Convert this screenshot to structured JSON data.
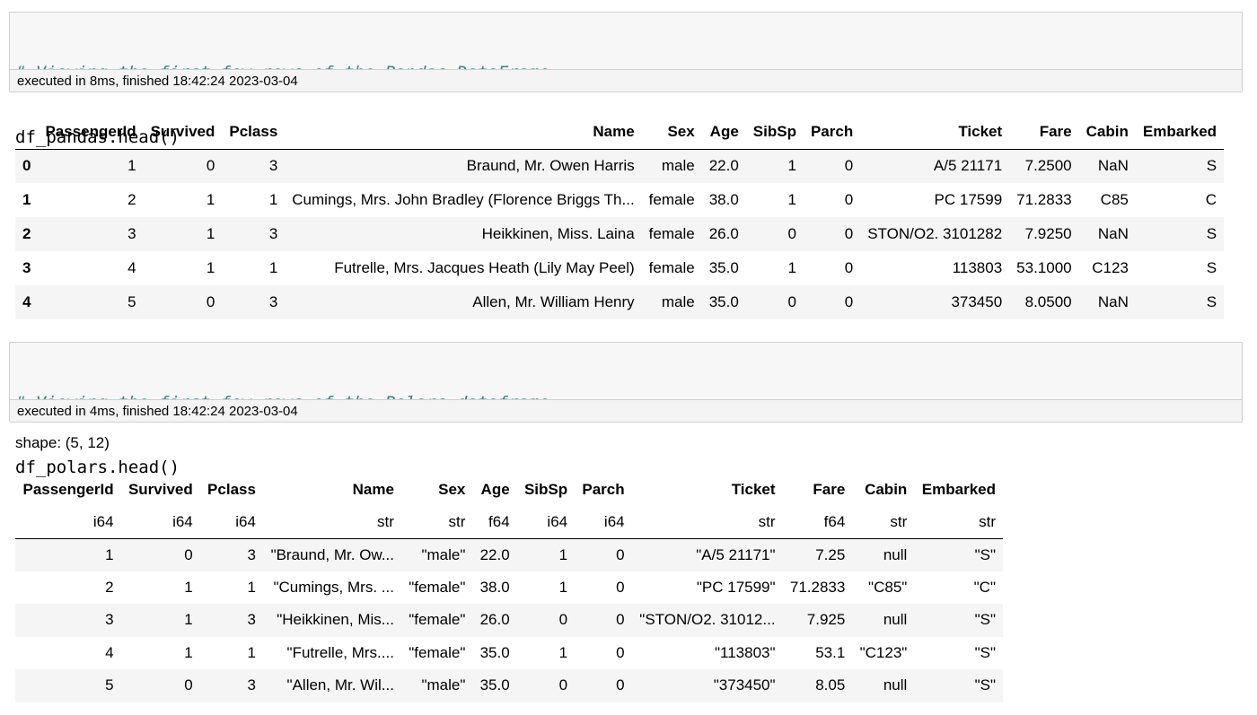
{
  "cell1": {
    "comment": "# Viewing the first few rows of the Pandas DataFrame",
    "code": "df_pandas.head()",
    "exec": "executed in 8ms, finished 18:42:24 2023-03-04"
  },
  "pandas_table": {
    "columns": [
      "",
      "PassengerId",
      "Survived",
      "Pclass",
      "Name",
      "Sex",
      "Age",
      "SibSp",
      "Parch",
      "Ticket",
      "Fare",
      "Cabin",
      "Embarked"
    ],
    "rows": [
      [
        "0",
        "1",
        "0",
        "3",
        "Braund, Mr. Owen Harris",
        "male",
        "22.0",
        "1",
        "0",
        "A/5 21171",
        "7.2500",
        "NaN",
        "S"
      ],
      [
        "1",
        "2",
        "1",
        "1",
        "Cumings, Mrs. John Bradley (Florence Briggs Th...",
        "female",
        "38.0",
        "1",
        "0",
        "PC 17599",
        "71.2833",
        "C85",
        "C"
      ],
      [
        "2",
        "3",
        "1",
        "3",
        "Heikkinen, Miss. Laina",
        "female",
        "26.0",
        "0",
        "0",
        "STON/O2. 3101282",
        "7.9250",
        "NaN",
        "S"
      ],
      [
        "3",
        "4",
        "1",
        "1",
        "Futrelle, Mrs. Jacques Heath (Lily May Peel)",
        "female",
        "35.0",
        "1",
        "0",
        "113803",
        "53.1000",
        "C123",
        "S"
      ],
      [
        "4",
        "5",
        "0",
        "3",
        "Allen, Mr. William Henry",
        "male",
        "35.0",
        "0",
        "0",
        "373450",
        "8.0500",
        "NaN",
        "S"
      ]
    ]
  },
  "cell2": {
    "comment": "# Viewing the first few rows of the Polars dataframe",
    "code": "df_polars.head()",
    "exec": "executed in 4ms, finished 18:42:24 2023-03-04"
  },
  "polars_shape": "shape: (5, 12)",
  "polars_table": {
    "columns": [
      "PassengerId",
      "Survived",
      "Pclass",
      "Name",
      "Sex",
      "Age",
      "SibSp",
      "Parch",
      "Ticket",
      "Fare",
      "Cabin",
      "Embarked"
    ],
    "dtypes": [
      "i64",
      "i64",
      "i64",
      "str",
      "str",
      "f64",
      "i64",
      "i64",
      "str",
      "f64",
      "str",
      "str"
    ],
    "rows": [
      [
        "1",
        "0",
        "3",
        "\"Braund, Mr. Ow...",
        "\"male\"",
        "22.0",
        "1",
        "0",
        "\"A/5 21171\"",
        "7.25",
        "null",
        "\"S\""
      ],
      [
        "2",
        "1",
        "1",
        "\"Cumings, Mrs. ...",
        "\"female\"",
        "38.0",
        "1",
        "0",
        "\"PC 17599\"",
        "71.2833",
        "\"C85\"",
        "\"C\""
      ],
      [
        "3",
        "1",
        "3",
        "\"Heikkinen, Mis...",
        "\"female\"",
        "26.0",
        "0",
        "0",
        "\"STON/O2. 31012...",
        "7.925",
        "null",
        "\"S\""
      ],
      [
        "4",
        "1",
        "1",
        "\"Futrelle, Mrs....",
        "\"female\"",
        "35.0",
        "1",
        "0",
        "\"113803\"",
        "53.1",
        "\"C123\"",
        "\"S\""
      ],
      [
        "5",
        "0",
        "3",
        "\"Allen, Mr. Wil...",
        "\"male\"",
        "35.0",
        "0",
        "0",
        "\"373450\"",
        "8.05",
        "null",
        "\"S\""
      ]
    ]
  }
}
